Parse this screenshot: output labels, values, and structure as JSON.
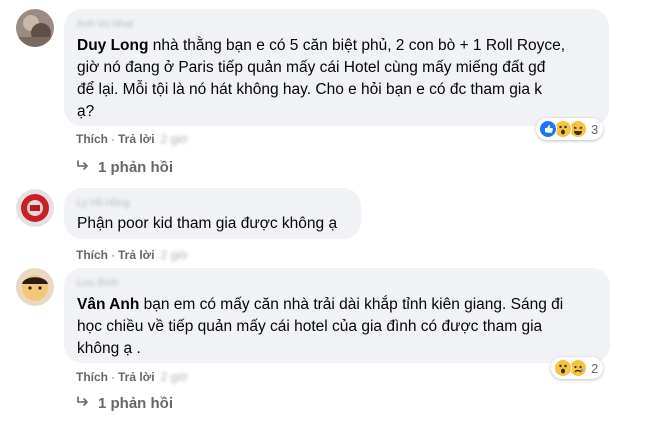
{
  "comments": [
    {
      "author": "Anh Vu Nhat",
      "mention": "Duy Long",
      "text_line1": " nhà thằng bạn e có 5 căn biệt phủ, 2 con bò + 1 Roll Royce,",
      "text_line2": "giờ nó đang ở Paris tiếp quản mấy cái Hotel cùng mấy miếng đất gđ",
      "text_line3": "để lại. Mỗi tội là nó hát không hay. Cho e hỏi bạn e có đc tham gia k",
      "text_line4": "ạ?",
      "like_label": "Thích",
      "reply_label": "Trả lời",
      "time": "2 giờ",
      "reaction_count": "3",
      "replies_label": "1 phản hồi"
    },
    {
      "author": "Ly Hồ Hồng",
      "text_line1": "Phận poor kid tham gia được không ạ",
      "like_label": "Thích",
      "reply_label": "Trả lời",
      "time": "2 giờ"
    },
    {
      "author": "Lưu Bình",
      "mention": "Vân Anh",
      "text_line1": " bạn em có mấy căn nhà trải dài khắp tỉnh kiên giang. Sáng đi",
      "text_line2": "học chiều về tiếp quản mấy cái hotel của gia đình có được tham gia",
      "text_line3": "không ạ .",
      "like_label": "Thích",
      "reply_label": "Trả lời",
      "time": "2 giờ",
      "reaction_count": "2",
      "replies_label": "1 phản hồi"
    }
  ],
  "colors": {
    "bubble": "#f0f2f5",
    "secondary_text": "#65676b",
    "like_blue": "#1877f2",
    "wow_yellow": "#f7c23e"
  }
}
